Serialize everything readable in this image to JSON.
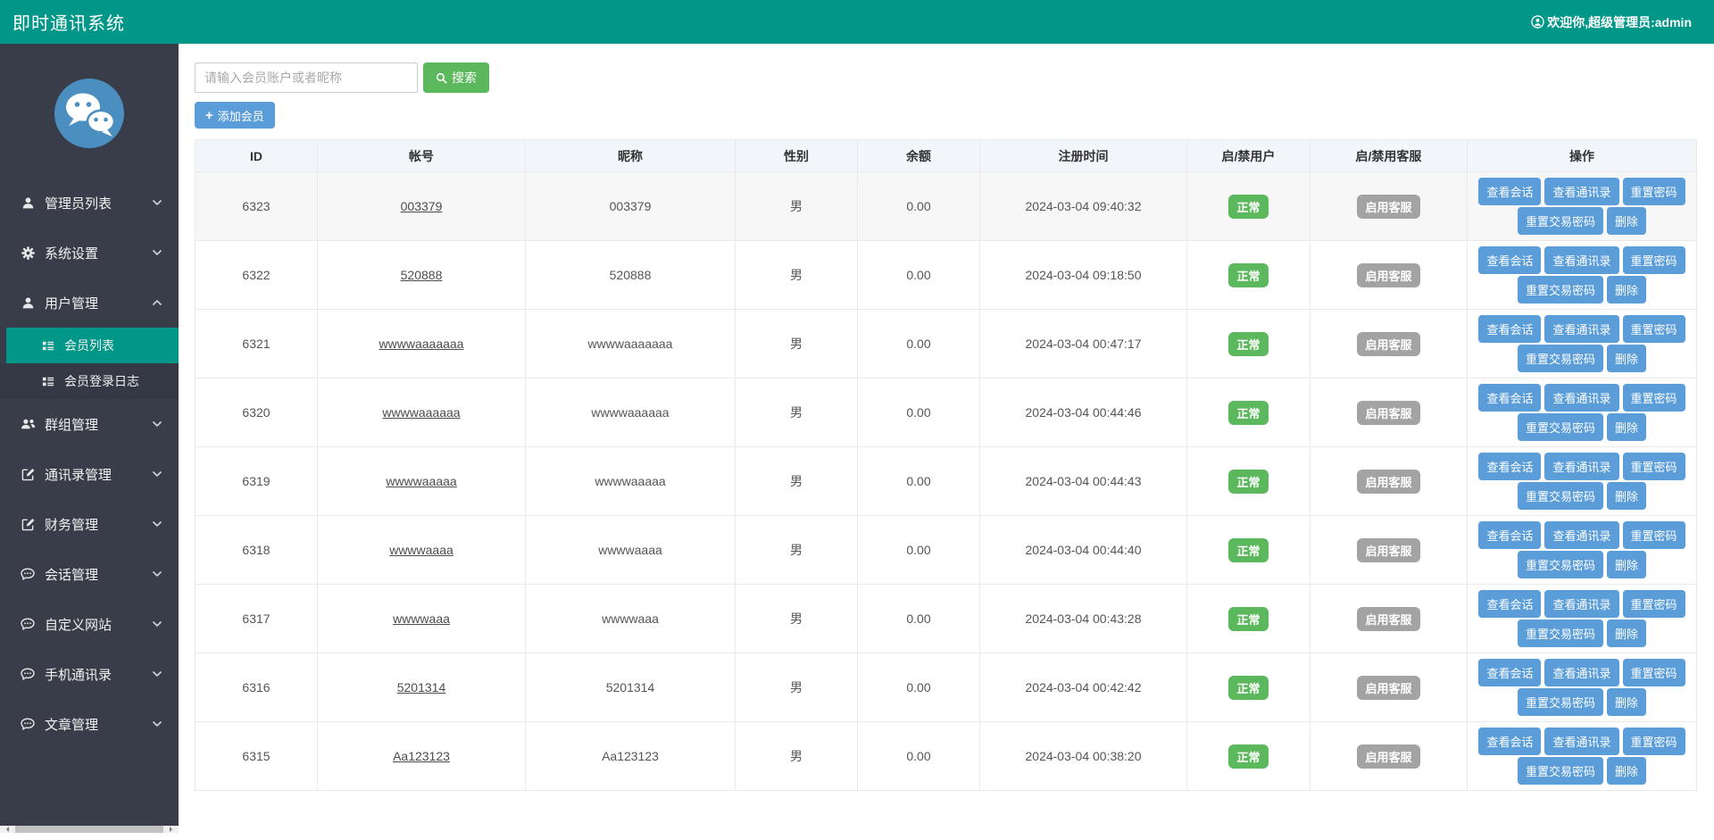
{
  "header": {
    "title": "即时通讯系统",
    "welcome": "欢迎你,超级管理员:admin"
  },
  "sidebar": {
    "menu": [
      {
        "name": "admin-list",
        "icon": "user-icon",
        "label": "管理员列表",
        "expanded": false
      },
      {
        "name": "system-settings",
        "icon": "gear-icon",
        "label": "系统设置",
        "expanded": false
      },
      {
        "name": "user-management",
        "icon": "user-icon",
        "label": "用户管理",
        "expanded": true,
        "children": [
          {
            "name": "member-list",
            "icon": "list-icon",
            "label": "会员列表",
            "active": true
          },
          {
            "name": "member-login-log",
            "icon": "list-icon",
            "label": "会员登录日志",
            "active": false
          }
        ]
      },
      {
        "name": "group-management",
        "icon": "users-icon",
        "label": "群组管理",
        "expanded": false
      },
      {
        "name": "contacts-management",
        "icon": "edit-icon",
        "label": "通讯录管理",
        "expanded": false
      },
      {
        "name": "finance-management",
        "icon": "edit-icon",
        "label": "财务管理",
        "expanded": false
      },
      {
        "name": "session-management",
        "icon": "comment-icon",
        "label": "会话管理",
        "expanded": false
      },
      {
        "name": "custom-website",
        "icon": "comment-icon",
        "label": "自定义网站",
        "expanded": false
      },
      {
        "name": "phone-contacts",
        "icon": "comment-icon",
        "label": "手机通讯录",
        "expanded": false
      },
      {
        "name": "article-management",
        "icon": "comment-icon",
        "label": "文章管理",
        "expanded": false
      }
    ]
  },
  "toolbar": {
    "search_placeholder": "请输入会员账户或者昵称",
    "search_label": "搜索",
    "add_member_label": "添加会员"
  },
  "table": {
    "columns": [
      "ID",
      "帐号",
      "昵称",
      "性别",
      "余额",
      "注册时间",
      "启/禁用户",
      "启/禁用客服",
      "操作"
    ],
    "action_labels": [
      "查看会话",
      "查看通讯录",
      "重置密码",
      "重置交易密码",
      "删除"
    ],
    "rows": [
      {
        "id": "6323",
        "account": "003379",
        "nickname": "003379",
        "gender": "男",
        "balance": "0.00",
        "registered": "2024-03-04 09:40:32",
        "user_status": "正常",
        "service_status": "启用客服"
      },
      {
        "id": "6322",
        "account": "520888",
        "nickname": "520888",
        "gender": "男",
        "balance": "0.00",
        "registered": "2024-03-04 09:18:50",
        "user_status": "正常",
        "service_status": "启用客服"
      },
      {
        "id": "6321",
        "account": "wwwwaaaaaaa",
        "nickname": "wwwwaaaaaaa",
        "gender": "男",
        "balance": "0.00",
        "registered": "2024-03-04 00:47:17",
        "user_status": "正常",
        "service_status": "启用客服"
      },
      {
        "id": "6320",
        "account": "wwwwaaaaaa",
        "nickname": "wwwwaaaaaa",
        "gender": "男",
        "balance": "0.00",
        "registered": "2024-03-04 00:44:46",
        "user_status": "正常",
        "service_status": "启用客服"
      },
      {
        "id": "6319",
        "account": "wwwwaaaaa",
        "nickname": "wwwwaaaaa",
        "gender": "男",
        "balance": "0.00",
        "registered": "2024-03-04 00:44:43",
        "user_status": "正常",
        "service_status": "启用客服"
      },
      {
        "id": "6318",
        "account": "wwwwaaaa",
        "nickname": "wwwwaaaa",
        "gender": "男",
        "balance": "0.00",
        "registered": "2024-03-04 00:44:40",
        "user_status": "正常",
        "service_status": "启用客服"
      },
      {
        "id": "6317",
        "account": "wwwwaaa",
        "nickname": "wwwwaaa",
        "gender": "男",
        "balance": "0.00",
        "registered": "2024-03-04 00:43:28",
        "user_status": "正常",
        "service_status": "启用客服"
      },
      {
        "id": "6316",
        "account": "5201314",
        "nickname": "5201314",
        "gender": "男",
        "balance": "0.00",
        "registered": "2024-03-04 00:42:42",
        "user_status": "正常",
        "service_status": "启用客服"
      },
      {
        "id": "6315",
        "account": "Aa123123",
        "nickname": "Aa123123",
        "gender": "男",
        "balance": "0.00",
        "registered": "2024-03-04 00:38:20",
        "user_status": "正常",
        "service_status": "启用客服"
      }
    ]
  },
  "colors": {
    "header_teal": "#009688",
    "sidebar_dark": "#393D49",
    "active_teal": "#009688",
    "button_blue": "#5b9dd8",
    "button_green": "#5cb85c",
    "badge_green": "#5cb85c",
    "badge_gray": "#a3a3a3",
    "logo_blue": "#4a8fc0"
  }
}
